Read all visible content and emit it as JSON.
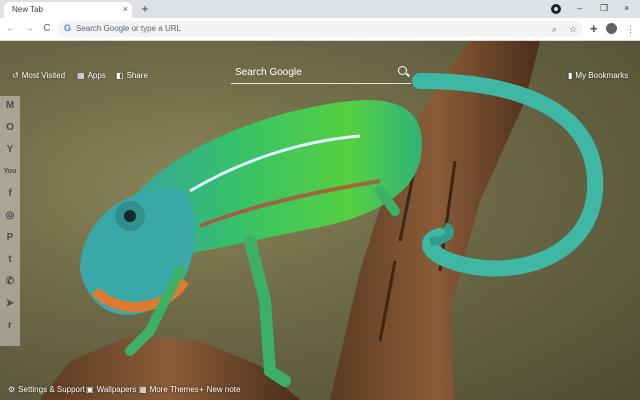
{
  "browser": {
    "tab_title": "New Tab",
    "tab_close": "×",
    "new_tab": "+",
    "window_controls": [
      "–",
      "❐",
      "×"
    ],
    "back": "←",
    "forward": "→",
    "reload": "C",
    "omnibox_placeholder": "Search Google or type a URL",
    "g_letter": "G",
    "zoom_icon": "⌕",
    "star_icon": "☆",
    "extensions_icon": "✚",
    "menu_icon": "⋮"
  },
  "newtab": {
    "top_left": [
      {
        "icon": "history-icon",
        "glyph": "↺",
        "label": "Most Visited"
      },
      {
        "icon": "apps-icon",
        "glyph": "▦",
        "label": "Apps"
      },
      {
        "icon": "share-icon",
        "glyph": "◧",
        "label": "Share"
      }
    ],
    "search_placeholder": "Search Google",
    "bookmarks": {
      "icon": "bookmark-icon",
      "glyph": "▮",
      "label": "My Bookmarks"
    },
    "sidebar": [
      {
        "name": "gmail-icon",
        "glyph": "M"
      },
      {
        "name": "outlook-icon",
        "glyph": "O"
      },
      {
        "name": "yahoo-icon",
        "glyph": "Y"
      },
      {
        "name": "youtube-icon",
        "glyph": "You"
      },
      {
        "name": "facebook-icon",
        "glyph": "f"
      },
      {
        "name": "instagram-icon",
        "glyph": "◎"
      },
      {
        "name": "pinterest-icon",
        "glyph": "P"
      },
      {
        "name": "twitter-icon",
        "glyph": "t"
      },
      {
        "name": "whatsapp-icon",
        "glyph": "✆"
      },
      {
        "name": "telegram-icon",
        "glyph": "➤"
      },
      {
        "name": "reddit-icon",
        "glyph": "r"
      }
    ],
    "bottom": [
      {
        "icon": "gear-icon",
        "glyph": "⚙",
        "label": "Settings & Support"
      },
      {
        "icon": "image-icon",
        "glyph": "▣",
        "label": "Wallpapers"
      },
      {
        "icon": "themes-icon",
        "glyph": "▦",
        "label": "More Themes"
      },
      {
        "icon": "note-icon",
        "glyph": "+",
        "label": "New note"
      }
    ]
  }
}
